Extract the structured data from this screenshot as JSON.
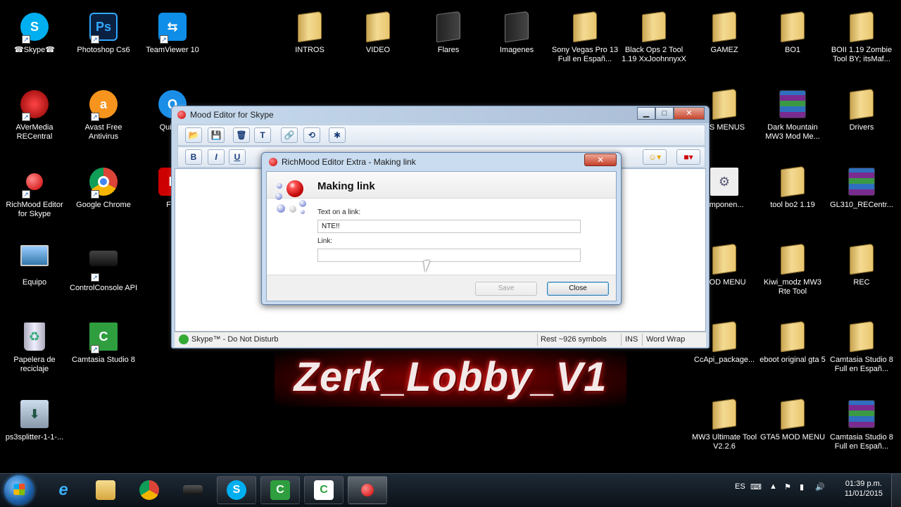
{
  "desktop": {
    "icons": [
      {
        "label": "☎Skype☎",
        "icon": "skype-icon"
      },
      {
        "label": "Photoshop Cs6",
        "icon": "photoshop-icon"
      },
      {
        "label": "TeamViewer 10",
        "icon": "teamviewer-icon"
      },
      {
        "label": "INTROS",
        "icon": "folder-icon"
      },
      {
        "label": "VIDEO",
        "icon": "folder-icon"
      },
      {
        "label": "Flares",
        "icon": "folder-icon"
      },
      {
        "label": "Imagenes",
        "icon": "folder-icon"
      },
      {
        "label": "Sony Vegas Pro 13 Full en Españ...",
        "icon": "folder-icon"
      },
      {
        "label": "Black Ops 2 Tool 1.19 XxJoohnnyxX",
        "icon": "folder-icon"
      },
      {
        "label": "GAMEZ",
        "icon": "folder-icon"
      },
      {
        "label": "BO1",
        "icon": "folder-icon"
      },
      {
        "label": "BOII 1.19 Zombie Tool BY; itsMaf...",
        "icon": "folder-icon"
      },
      {
        "label": "AVerMedia RECentral",
        "icon": "avermedia-icon"
      },
      {
        "label": "Avast Free Antivirus",
        "icon": "avast-icon"
      },
      {
        "label": "QuickTi",
        "icon": "quicktime-icon"
      },
      {
        "label": "DS MENUS",
        "icon": "folder-icon"
      },
      {
        "label": "Dark Mountain MW3 Mod Me...",
        "icon": "winrar-icon"
      },
      {
        "label": "Drivers",
        "icon": "folder-icon"
      },
      {
        "label": "RichMood Editor for Skype",
        "icon": "richmood-icon"
      },
      {
        "label": "Google Chrome",
        "icon": "chrome-icon"
      },
      {
        "label": "File",
        "icon": "file-icon"
      },
      {
        "label": "omponen...",
        "icon": "settings-file-icon"
      },
      {
        "label": "tool bo2 1.19",
        "icon": "folder-icon"
      },
      {
        "label": "GL310_RECentr...",
        "icon": "winrar-icon"
      },
      {
        "label": "Equipo",
        "icon": "computer-icon"
      },
      {
        "label": "ControlConsole API",
        "icon": "ps3-icon"
      },
      {
        "label": "MOD MENU",
        "icon": "folder-icon"
      },
      {
        "label": "Kiwi_modz MW3 Rte Tool",
        "icon": "folder-icon"
      },
      {
        "label": "REC",
        "icon": "folder-icon"
      },
      {
        "label": "Papelera de reciclaje",
        "icon": "recycle-bin-icon"
      },
      {
        "label": "Camtasia Studio 8",
        "icon": "camtasia-icon"
      },
      {
        "label": "CcApi_package...",
        "icon": "folder-icon"
      },
      {
        "label": "eboot original gta 5",
        "icon": "folder-icon"
      },
      {
        "label": "Camtasia Studio 8 Full en Españ...",
        "icon": "folder-icon"
      },
      {
        "label": "ps3splitter-1-1-...",
        "icon": "installer-icon"
      },
      {
        "label": "MW3 Ultimate Tool V2.2.6",
        "icon": "folder-icon"
      },
      {
        "label": "GTA5 MOD MENU",
        "icon": "folder-icon"
      },
      {
        "label": "Camtasia Studio 8 Full en Españ...",
        "icon": "winrar-icon"
      }
    ]
  },
  "banner": {
    "text": "Zerk_Lobby_V1"
  },
  "main_window": {
    "title": "Mood Editor for Skype",
    "btn_minimize": "▁",
    "btn_maximize": "□",
    "btn_close": "✕",
    "toolbar1": [
      "open-icon",
      "save-icon",
      "clear-icon",
      "T",
      "link-icon",
      "unlink-icon",
      "special-icon"
    ],
    "toolbar2": {
      "bold": "B",
      "italic": "I",
      "underline": "U"
    },
    "status": {
      "mood": "Skype™ - Do Not Disturb",
      "rest": "Rest ~926 symbols",
      "ins": "INS",
      "wrap": "Word Wrap"
    }
  },
  "dialog": {
    "title": "RichMood Editor Extra - Making link",
    "close_label": "✕",
    "heading": "Making link",
    "text_label": "Text on a link:",
    "text_value": "NTE!!",
    "link_label": "Link:",
    "link_value": "",
    "save_label": "Save",
    "close_button_label": "Close"
  },
  "taskbar": {
    "items": [
      "internet-explorer-icon",
      "explorer-icon",
      "chrome-icon",
      "ps3-icon",
      "skype-icon",
      "camtasia-icon",
      "camtasia-recorder-icon",
      "richmood-icon"
    ],
    "lang": "ES",
    "time": "01:39 p.m.",
    "date": "11/01/2015"
  },
  "colors": {
    "desktop_bg": "#000000",
    "folder": "#f0d37f",
    "dialog_frame": "#c9dcf0",
    "banner_red": "#8b0000"
  }
}
